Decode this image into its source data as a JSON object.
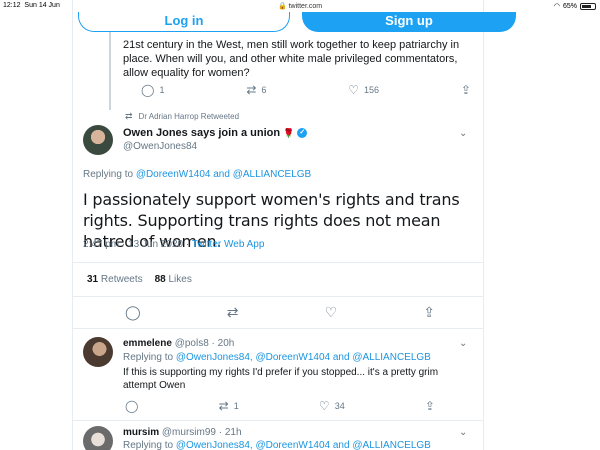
{
  "statusbar": {
    "time": "12:12",
    "date": "Sun 14 Jun",
    "url": "twitter.com",
    "battery": "65%"
  },
  "auth": {
    "login": "Log in",
    "signup": "Sign up"
  },
  "prev_tweet": {
    "text": "21st century in the West, men still work together to keep patriarchy in place. When will you, and other white male privileged commentators, allow equality for women?",
    "replies": "1",
    "retweets": "6",
    "likes": "156"
  },
  "retweeted_by": "Dr Adrian Harrop Retweeted",
  "main_tweet": {
    "name": "Owen Jones says join a union",
    "rose": "🌹",
    "handle": "@OwenJones84",
    "replying_prefix": "Replying to",
    "replying_to_1": "@DoreenW1404",
    "replying_and": "and",
    "replying_to_2": "@ALLIANCELGB",
    "text": "I passionately support women's rights and trans rights. Supporting trans rights does not mean hatred of women.",
    "time": "2:47 pm · 13 Jun 2020 · ",
    "source": "Twitter Web App",
    "retweets_count": "31",
    "retweets_label": "Retweets",
    "likes_count": "88",
    "likes_label": "Likes"
  },
  "replies": [
    {
      "name": "emmelene",
      "handle_time": "@pols8 · 20h",
      "replying_prefix": "Replying to",
      "mentions": "@OwenJones84, @DoreenW1404 and @ALLIANCELGB",
      "text": "If this is supporting my rights I'd prefer if you stopped... it's a pretty grim attempt Owen",
      "retweets": "1",
      "likes": "34"
    },
    {
      "name": "mursim",
      "handle_time": "@mursim99 · 21h",
      "replying_prefix": "Replying to",
      "mentions": "@OwenJones84, @DoreenW1404 and @ALLIANCELGB"
    }
  ],
  "icons": [
    "reply-icon",
    "retweet-icon",
    "like-icon",
    "share-icon",
    "verified-icon",
    "chevron-down-icon",
    "wifi-icon",
    "battery-icon",
    "lock-icon"
  ]
}
